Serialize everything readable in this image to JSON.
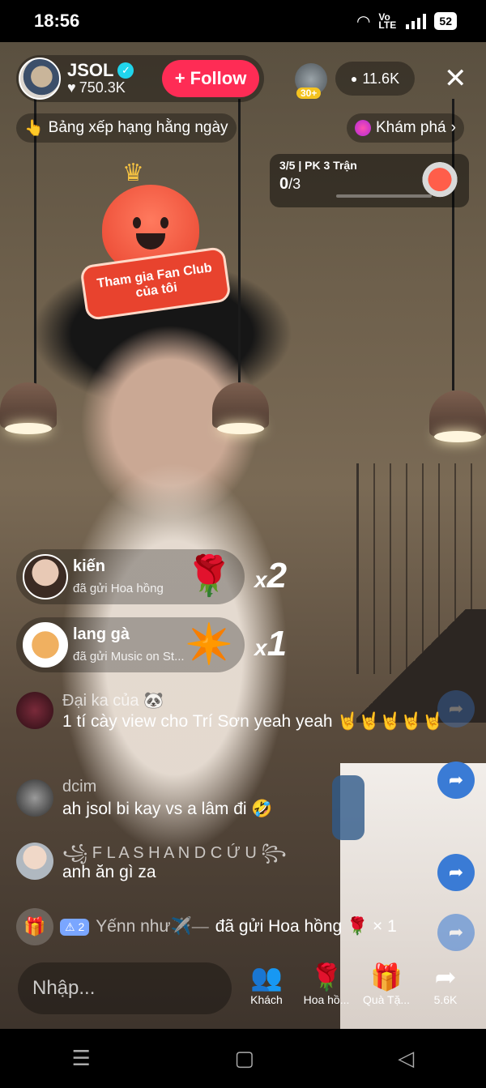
{
  "status_bar": {
    "time": "18:56",
    "network": "Vo LTE",
    "battery": "52"
  },
  "host": {
    "name": "JSOL",
    "likes": "750.3K",
    "follow_label": "+ Follow"
  },
  "top_right": {
    "rank_badge": "30+",
    "viewers": "11.6K"
  },
  "chips": {
    "ranking": "Bảng xếp hạng hằng ngày",
    "explore": "Khám phá"
  },
  "pk": {
    "match": "3/5",
    "title": "PK 3 Trận",
    "score": "0",
    "total": "/3",
    "progress": 0
  },
  "fan_club": {
    "line1": "Tham gia Fan Club",
    "line2": "của tôi"
  },
  "gifts": [
    {
      "user": "kiến",
      "action": "đã gửi Hoa hồng",
      "icon": "🌹",
      "multiplier_x": "x",
      "multiplier_n": "2"
    },
    {
      "user": "lang gà",
      "action": "đã gửi Music on St...",
      "icon": "✴️",
      "multiplier_x": "x",
      "multiplier_n": "1"
    }
  ],
  "comments": [
    {
      "user": "Đại ka của 🐼",
      "text": "1 tí cày view cho Trí Sơn yeah yeah 🤘🤘🤘🤘🤘"
    },
    {
      "user": "dcim",
      "text": "ah jsol bi kay vs a lâm đi 🤣"
    },
    {
      "user": "꧁ F L A S H A N D C Ứ U ꧂",
      "text": "anh ăn gì za"
    }
  ],
  "system_message": {
    "level": "2",
    "user": "Yếnn như✈️⎯⎯",
    "action": "đã gửi Hoa hồng 🌹 × 1"
  },
  "input": {
    "placeholder": "Nhập..."
  },
  "actions": [
    {
      "label": "Khách",
      "icon": "👥"
    },
    {
      "label": "Hoa hồ...",
      "icon": "🌹"
    },
    {
      "label": "Quà Tặ...",
      "icon": "🎁"
    },
    {
      "label": "5.6K",
      "icon": "➦"
    }
  ],
  "colors": {
    "follow": "#fe2c55",
    "share_fab": "#3a7bd5",
    "verified": "#20d5ec"
  }
}
